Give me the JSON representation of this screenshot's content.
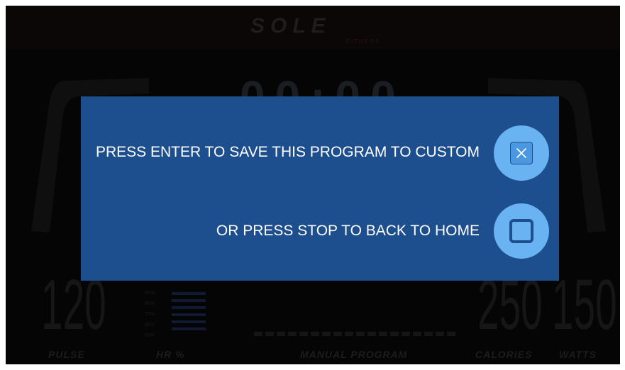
{
  "background": {
    "brand": "SOLE",
    "brand_sub": "FITNESS",
    "time": "00:00",
    "pulse_value": "120",
    "calories_value": "250",
    "watts_value": "150",
    "hr_scale": [
      "90%",
      "80%",
      "70%",
      "60%",
      "50%"
    ],
    "labels": {
      "pulse": "PULSE",
      "hr": "HR %",
      "program": "MANUAL PROGRAM",
      "calories": "CALORIES",
      "watts": "WATTS"
    }
  },
  "dialog": {
    "save_prompt": "PRESS ENTER TO SAVE THIS PROGRAM TO CUSTOM",
    "home_prompt": "OR PRESS STOP TO BACK TO HOME",
    "enter_icon": "x-box-icon",
    "stop_icon": "square-stop-icon"
  },
  "colors": {
    "dialog_bg": "#1d4e8e",
    "button_bg": "#6ab3f3",
    "screen_bg": "#050505",
    "text": "#ffffff"
  }
}
